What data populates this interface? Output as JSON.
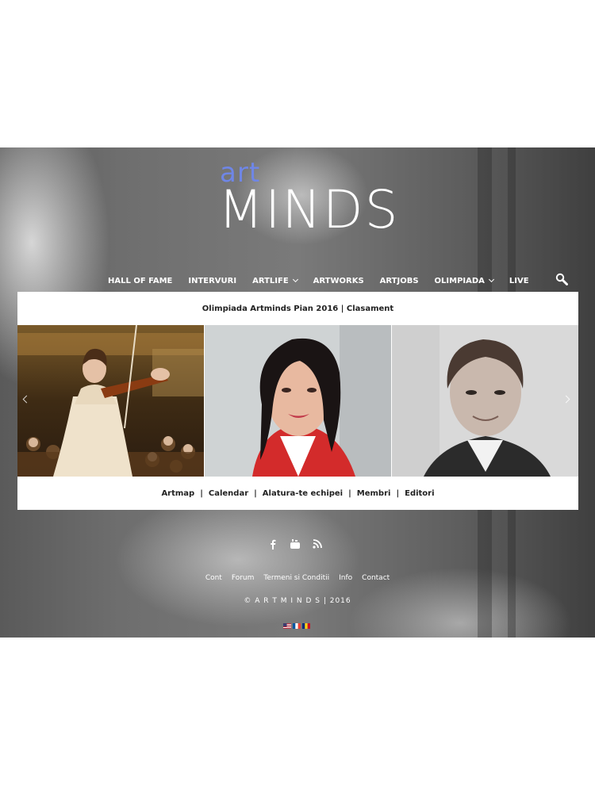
{
  "logo": {
    "art": "art",
    "minds": "MINDS"
  },
  "nav": {
    "items": [
      {
        "label": "HALL OF FAME",
        "caret": false
      },
      {
        "label": "INTERVURI",
        "caret": false
      },
      {
        "label": "ARTLIFE",
        "caret": true
      },
      {
        "label": "ARTWORKS",
        "caret": false
      },
      {
        "label": "ARTJOBS",
        "caret": false
      },
      {
        "label": "OLIMPIADA",
        "caret": true
      },
      {
        "label": "LIVE",
        "caret": false
      }
    ],
    "search_icon": "search-icon"
  },
  "panel": {
    "headline": "Olimpiada Artminds  Pian 2016 | Clasament",
    "slides": [
      "violinist-photo",
      "singer-photo",
      "pianist-photo"
    ],
    "links": [
      "Artmap",
      "Calendar",
      "Alatura-te echipei",
      "Membri",
      "Editori"
    ],
    "separator": "|"
  },
  "social": [
    "facebook-icon",
    "youtube-icon",
    "rss-icon"
  ],
  "footer": {
    "links": [
      "Cont",
      "Forum",
      "Termeni si Conditii",
      "Info",
      "Contact"
    ],
    "copyright": "© A R T M I N D S | 2016"
  },
  "languages": [
    "en",
    "fr",
    "ro"
  ],
  "colors": {
    "accent": "#6f86e6",
    "text_light": "#ffffff",
    "text_dark": "#222222"
  }
}
